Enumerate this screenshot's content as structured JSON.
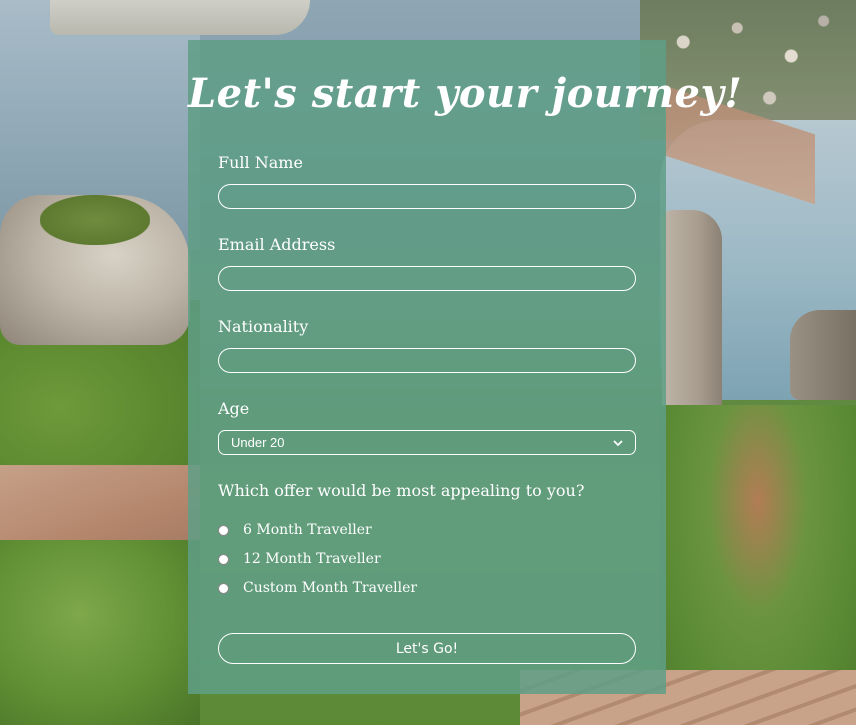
{
  "form": {
    "title": "Let's start your journey!",
    "fields": [
      {
        "label": "Full Name",
        "value": "",
        "placeholder": ""
      },
      {
        "label": "Email Address",
        "value": "",
        "placeholder": ""
      },
      {
        "label": "Nationality",
        "value": "",
        "placeholder": ""
      }
    ],
    "age": {
      "label": "Age",
      "selected": "Under 20"
    },
    "offer": {
      "question": "Which offer would be most appealing to you?",
      "options": [
        "6 Month Traveller",
        "12 Month Traveller",
        "Custom Month Traveller"
      ]
    },
    "submit_label": "Let's Go!"
  },
  "colors": {
    "panel": "#5f9e86",
    "text": "#ffffff"
  }
}
